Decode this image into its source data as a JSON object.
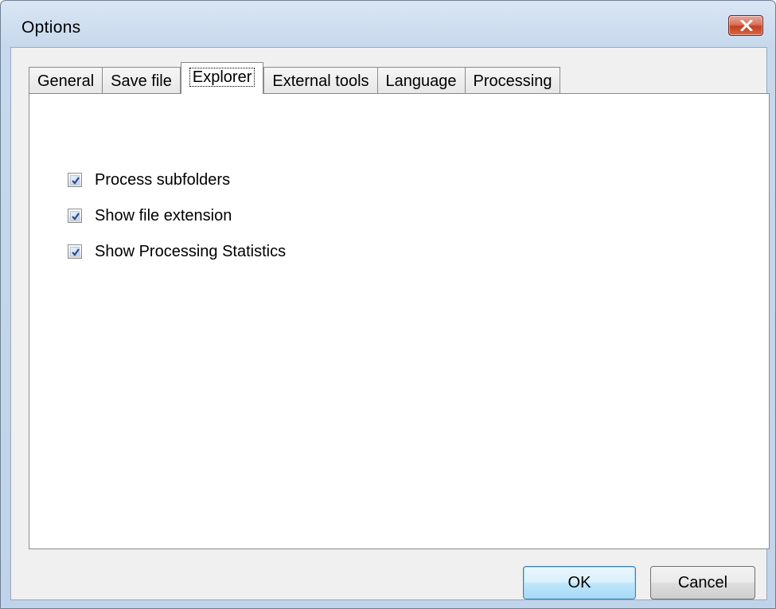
{
  "window": {
    "title": "Options",
    "close_icon": "close-icon"
  },
  "tabs": [
    {
      "label": "General",
      "active": false
    },
    {
      "label": "Save file",
      "active": false
    },
    {
      "label": "Explorer",
      "active": true
    },
    {
      "label": "External tools",
      "active": false
    },
    {
      "label": "Language",
      "active": false
    },
    {
      "label": "Processing",
      "active": false
    }
  ],
  "options": [
    {
      "label": "Process subfolders",
      "checked": true
    },
    {
      "label": "Show file extension",
      "checked": true
    },
    {
      "label": "Show Processing Statistics",
      "checked": true,
      "highlighted": true
    }
  ],
  "buttons": {
    "ok": "OK",
    "cancel": "Cancel"
  },
  "colors": {
    "highlight_ring": "#a72666",
    "close_button": "#c2401f",
    "default_button_border": "#3c7fb1"
  }
}
